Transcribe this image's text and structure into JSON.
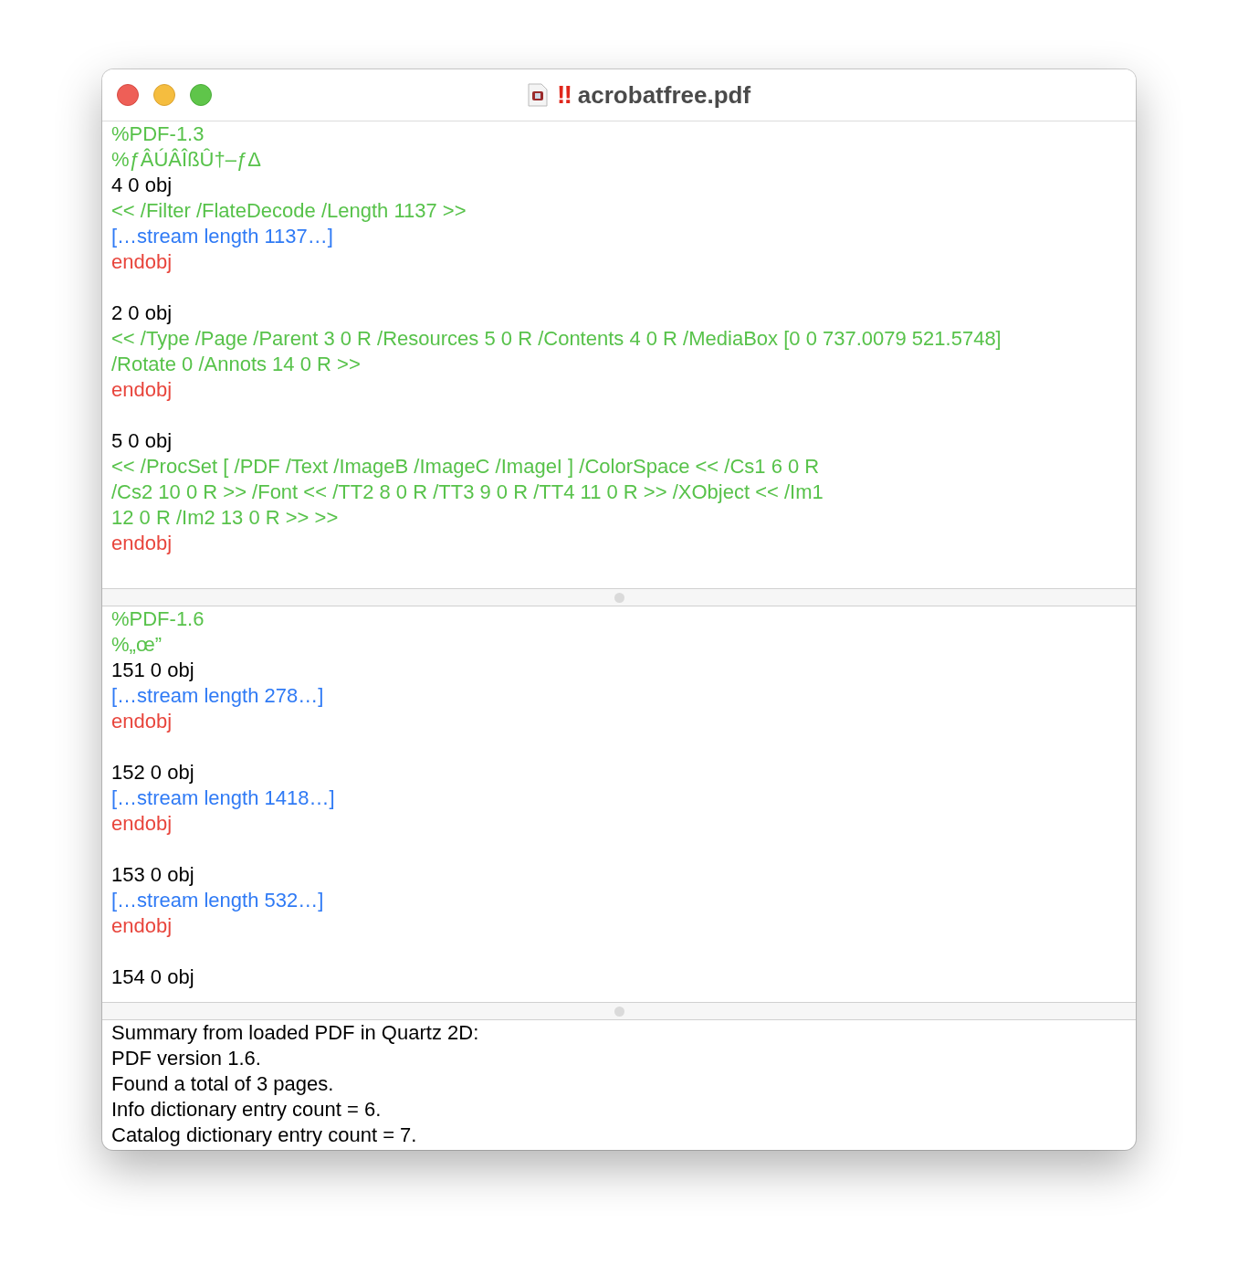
{
  "window": {
    "title": "acrobatfree.pdf",
    "badge": "‼"
  },
  "panes": [
    {
      "lines": [
        {
          "kind": "comment",
          "text": "%PDF-1.3"
        },
        {
          "kind": "comment",
          "text": "%ƒÂÚÂÎßÛ†–ƒΔ"
        },
        {
          "kind": "object",
          "text": "4 0 obj"
        },
        {
          "kind": "dict",
          "text": "<< /Filter /FlateDecode /Length 1137 >>"
        },
        {
          "kind": "stream",
          "text": "[…stream length 1137…]"
        },
        {
          "kind": "endobj",
          "text": "endobj"
        },
        {
          "kind": "blank"
        },
        {
          "kind": "object",
          "text": "2 0 obj"
        },
        {
          "kind": "dict",
          "text": "<< /Type /Page /Parent 3 0 R /Resources 5 0 R /Contents 4 0 R /MediaBox [0 0 737.0079 521.5748]"
        },
        {
          "kind": "dict",
          "text": "/Rotate 0 /Annots 14 0 R >>"
        },
        {
          "kind": "endobj",
          "text": "endobj"
        },
        {
          "kind": "blank"
        },
        {
          "kind": "object",
          "text": "5 0 obj"
        },
        {
          "kind": "dict",
          "text": "<< /ProcSet [ /PDF /Text /ImageB /ImageC /ImageI ] /ColorSpace << /Cs1 6 0 R"
        },
        {
          "kind": "dict",
          "text": "/Cs2 10 0 R >> /Font << /TT2 8 0 R /TT3 9 0 R /TT4 11 0 R >> /XObject << /Im1"
        },
        {
          "kind": "dict",
          "text": "12 0 R /Im2 13 0 R >> >>"
        },
        {
          "kind": "endobj",
          "text": "endobj"
        },
        {
          "kind": "blank"
        }
      ]
    },
    {
      "lines": [
        {
          "kind": "comment",
          "text": "%PDF-1.6"
        },
        {
          "kind": "comment",
          "text": "%„œ”"
        },
        {
          "kind": "object",
          "text": "151 0 obj"
        },
        {
          "kind": "stream",
          "text": "[…stream length 278…]"
        },
        {
          "kind": "endobj",
          "text": "endobj"
        },
        {
          "kind": "blank"
        },
        {
          "kind": "object",
          "text": "152 0 obj"
        },
        {
          "kind": "stream",
          "text": "[…stream length 1418…]"
        },
        {
          "kind": "endobj",
          "text": "endobj"
        },
        {
          "kind": "blank"
        },
        {
          "kind": "object",
          "text": "153 0 obj"
        },
        {
          "kind": "stream",
          "text": "[…stream length 532…]"
        },
        {
          "kind": "endobj",
          "text": "endobj"
        },
        {
          "kind": "blank"
        },
        {
          "kind": "object",
          "text": "154 0 obj"
        }
      ]
    }
  ],
  "summary": [
    "Summary from loaded PDF in Quartz 2D:",
    "PDF version 1.6.",
    "Found a total of 3 pages.",
    "Info dictionary entry count = 6.",
    "Catalog dictionary entry count = 7."
  ]
}
